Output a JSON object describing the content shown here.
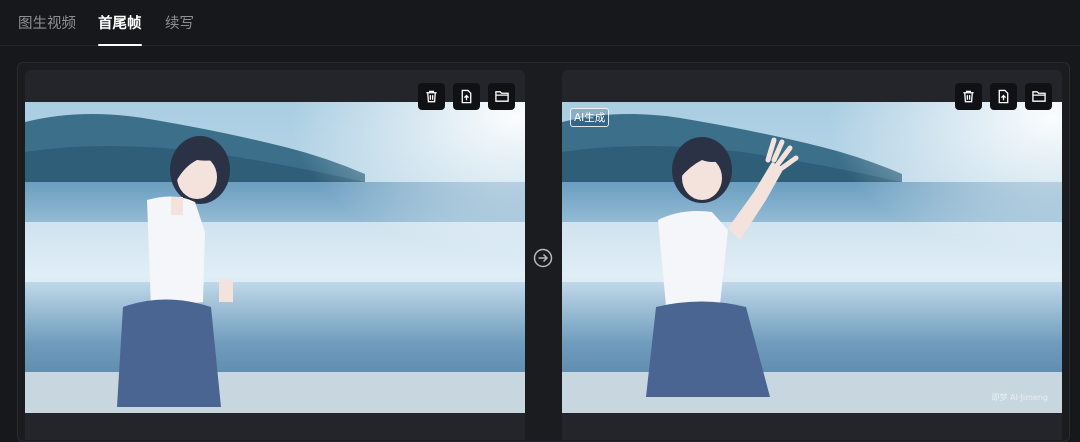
{
  "tabs": [
    {
      "label": "图生视频",
      "active": false
    },
    {
      "label": "首尾帧",
      "active": true
    },
    {
      "label": "续写",
      "active": false
    }
  ],
  "first_frame": {
    "toolbar": [
      "trash-icon",
      "upload-icon",
      "folder-icon"
    ]
  },
  "last_frame": {
    "toolbar": [
      "trash-icon",
      "upload-icon",
      "folder-icon"
    ],
    "badge": "AI生成",
    "watermark": "即梦 AI·Jimeng"
  },
  "connector_icon": "arrow-right-circle-icon",
  "colors": {
    "background": "#17181c",
    "card": "#24252a",
    "tab_active": "#ffffff",
    "tab_inactive": "#8e8f94"
  }
}
